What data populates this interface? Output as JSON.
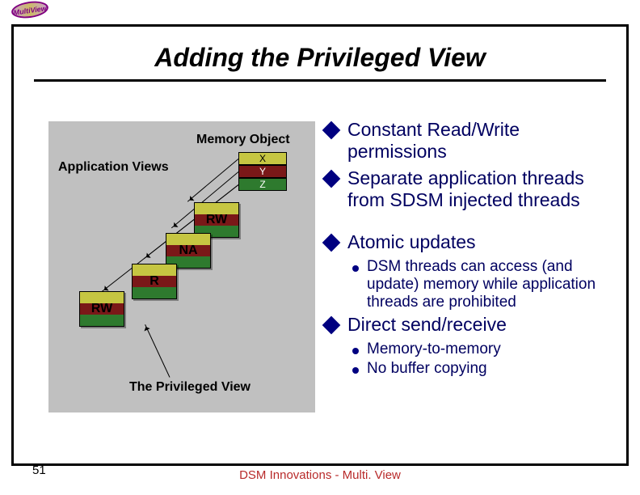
{
  "logo_text": "MultiView",
  "title": "Adding the Privileged View",
  "diagram": {
    "memory_object_label": "Memory Object",
    "application_views_label": "Application Views",
    "privileged_view_label": "The Privileged View",
    "cells": {
      "x": "X",
      "y": "Y",
      "z": "Z"
    },
    "views": {
      "rw1": "RW",
      "na": "NA",
      "r": "R",
      "rw2": "RW"
    }
  },
  "bullets": [
    {
      "level": 1,
      "text": "Constant Read/Write permissions"
    },
    {
      "level": 1,
      "text": "Separate application threads from SDSM injected threads"
    },
    {
      "level": 0,
      "text": ""
    },
    {
      "level": 1,
      "text": "Atomic updates"
    },
    {
      "level": 2,
      "text": "DSM threads can access (and update) memory while application threads are prohibited"
    },
    {
      "level": 1,
      "text": "Direct send/receive"
    },
    {
      "level": 2,
      "text": "Memory-to-memory"
    },
    {
      "level": 2,
      "text": "No buffer copying"
    }
  ],
  "page_number": "51",
  "footer": "DSM Innovations  - Multi. View"
}
